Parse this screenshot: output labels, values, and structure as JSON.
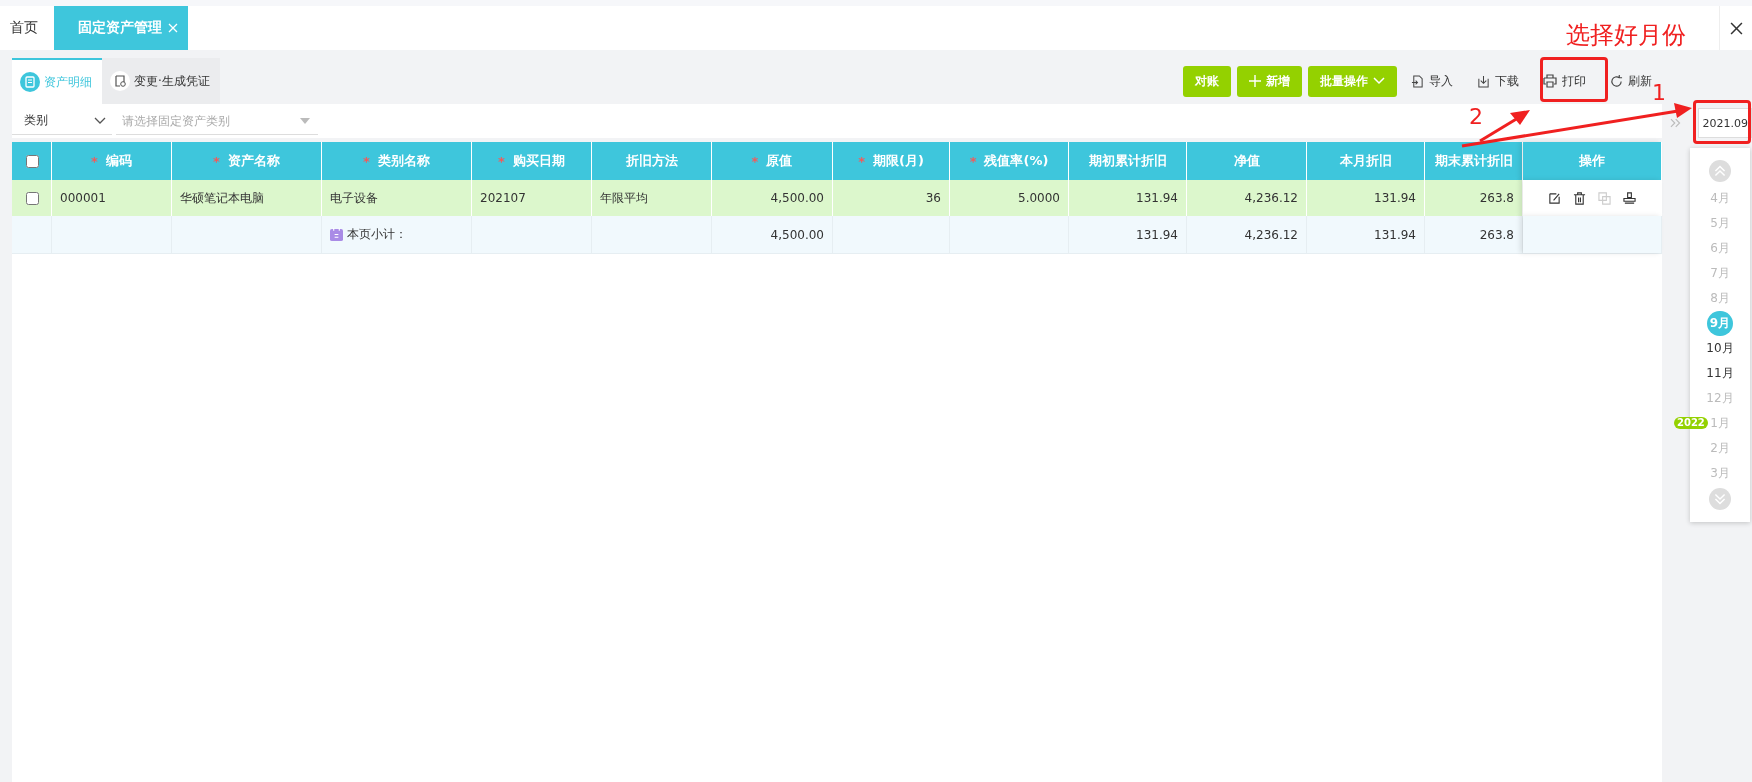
{
  "top_tabs": [
    {
      "label": "首页",
      "selected": false,
      "closable": false
    },
    {
      "label": "固定资产管理",
      "selected": true,
      "closable": true
    }
  ],
  "sub_tabs": [
    {
      "label": "资产明细",
      "selected": true,
      "kind": "detail"
    },
    {
      "label": "变更·生成凭证",
      "selected": false,
      "kind": "voucher"
    }
  ],
  "toolbar": [
    {
      "label": "对账",
      "kind": "primary"
    },
    {
      "label": "新增",
      "kind": "add"
    },
    {
      "label": "批量操作",
      "kind": "dropdown"
    },
    {
      "label": "导入",
      "kind": "import"
    },
    {
      "label": "下载",
      "kind": "download"
    },
    {
      "label": "打印",
      "kind": "print"
    },
    {
      "label": "刷新",
      "kind": "refresh"
    }
  ],
  "filters": {
    "category_label": "类别",
    "category_placeholder": "请选择固定资产类别"
  },
  "table": {
    "select_all_checked": false,
    "required_mark": "*",
    "columns": [
      {
        "label": "编码",
        "required": true,
        "kind": "text"
      },
      {
        "label": "资产名称",
        "required": true,
        "kind": "text"
      },
      {
        "label": "类别名称",
        "required": true,
        "kind": "text"
      },
      {
        "label": "购买日期",
        "required": true,
        "kind": "text"
      },
      {
        "label": "折旧方法",
        "required": false,
        "kind": "text"
      },
      {
        "label": "原值",
        "required": true,
        "kind": "number"
      },
      {
        "label": "期限(月)",
        "required": true,
        "kind": "number"
      },
      {
        "label": "残值率(%)",
        "required": true,
        "kind": "number"
      },
      {
        "label": "期初累计折旧",
        "required": false,
        "kind": "number"
      },
      {
        "label": "净值",
        "required": false,
        "kind": "number"
      },
      {
        "label": "本月折旧",
        "required": false,
        "kind": "number"
      },
      {
        "label": "期末累计折旧",
        "required": false,
        "kind": "number"
      }
    ],
    "actions_header": "操作",
    "rows": [
      {
        "checked": false,
        "cells": [
          "000001",
          "华硕笔记本电脑",
          "电子设备",
          "202107",
          "年限平均",
          "4,500.00",
          "36",
          "5.0000",
          "131.94",
          "4,236.12",
          "131.94",
          "263.8"
        ],
        "actions": [
          {
            "kind": "edit",
            "disabled": false
          },
          {
            "kind": "delete",
            "disabled": false
          },
          {
            "kind": "copy",
            "disabled": true
          },
          {
            "kind": "stamp",
            "disabled": false
          }
        ]
      }
    ],
    "subtotal": [
      {
        "kind": "blank"
      },
      {
        "kind": "blank"
      },
      {
        "kind": "label",
        "text": "本页小计："
      },
      {
        "kind": "blank"
      },
      {
        "kind": "blank"
      },
      {
        "kind": "value",
        "text": "4,500.00"
      },
      {
        "kind": "blank"
      },
      {
        "kind": "blank"
      },
      {
        "kind": "value",
        "text": "131.94"
      },
      {
        "kind": "value",
        "text": "4,236.12"
      },
      {
        "kind": "value",
        "text": "131.94"
      },
      {
        "kind": "value",
        "text": "263.8"
      }
    ]
  },
  "period": {
    "value": "2021.09"
  },
  "months": [
    {
      "label": "4月",
      "selected": false,
      "disabled": true
    },
    {
      "label": "5月",
      "selected": false,
      "disabled": true
    },
    {
      "label": "6月",
      "selected": false,
      "disabled": true
    },
    {
      "label": "7月",
      "selected": false,
      "disabled": true
    },
    {
      "label": "8月",
      "selected": false,
      "disabled": true
    },
    {
      "label": "9月",
      "selected": true,
      "disabled": false
    },
    {
      "label": "10月",
      "selected": false,
      "disabled": false
    },
    {
      "label": "11月",
      "selected": false,
      "disabled": false
    },
    {
      "label": "12月",
      "selected": false,
      "disabled": true
    },
    {
      "label": "1月",
      "selected": false,
      "disabled": true,
      "year_badge": "2022"
    },
    {
      "label": "2月",
      "selected": false,
      "disabled": true
    },
    {
      "label": "3月",
      "selected": false,
      "disabled": true
    }
  ],
  "annotations": {
    "title": "选择好月份",
    "step_1": "1",
    "step_2": "2"
  }
}
